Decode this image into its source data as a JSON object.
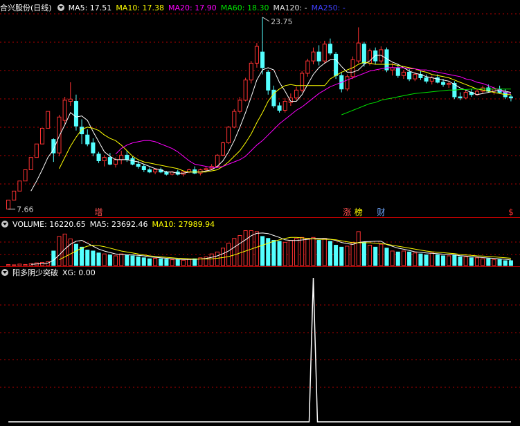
{
  "main_header": {
    "title": "合兴股份(日线)",
    "ma5": "MA5: 17.51",
    "ma10": "MA10: 17.38",
    "ma20": "MA20: 17.90",
    "ma60": "MA60: 18.30",
    "ma120": "MA120: -",
    "ma250": "MA250: -"
  },
  "volume_header": {
    "title": "VOLUME: 16220.65",
    "ma5": "MA5: 23692.46",
    "ma10": "MA10: 27989.94"
  },
  "indicator_header": {
    "title": "阳多阴少突破",
    "xg": "XG: 0.00"
  },
  "colors": {
    "up": "#ff3232",
    "down": "#54ffff",
    "ma5": "#ffffff",
    "ma10": "#ffff00",
    "ma20": "#ff00ff",
    "ma60": "#00e600",
    "grid": "#b40000",
    "ma120": "#e0e0e0",
    "ma250": "#4040ff"
  },
  "chart_data": [
    {
      "type": "candlestick",
      "title": "合兴股份(日线)",
      "ylim": [
        7.0,
        25.0
      ],
      "annotations": {
        "high_label": "23.75",
        "low_label": "7.66",
        "event_markers": [
          {
            "text": "增",
            "index": 16,
            "color": "#ff5050"
          },
          {
            "text": "涨",
            "index": 60,
            "color": "#ff5050"
          },
          {
            "text": "榜",
            "index": 62,
            "color": "#ffff00"
          },
          {
            "text": "财",
            "index": 66,
            "color": "#6fa8ff"
          },
          {
            "text": "$",
            "index": 89,
            "color": "#ff3232"
          }
        ]
      },
      "candles": [
        [
          7.6,
          8.4,
          7.6,
          8.4
        ],
        [
          8.4,
          9.2,
          8.4,
          9.2
        ],
        [
          9.2,
          10.1,
          9.2,
          10.1
        ],
        [
          10.1,
          11.1,
          10.1,
          11.1
        ],
        [
          11.1,
          12.2,
          11.1,
          12.2
        ],
        [
          12.2,
          13.4,
          12.2,
          13.4
        ],
        [
          13.4,
          14.8,
          13.4,
          14.8
        ],
        [
          14.8,
          16.3,
          14.8,
          16.3
        ],
        [
          13.8,
          13.9,
          11.8,
          12.6
        ],
        [
          12.6,
          16.0,
          12.3,
          15.8
        ],
        [
          15.5,
          17.6,
          15.2,
          17.3
        ],
        [
          17.2,
          18.9,
          16.8,
          17.4
        ],
        [
          17.2,
          17.8,
          14.6,
          15.0
        ],
        [
          14.9,
          15.6,
          13.4,
          14.3
        ],
        [
          14.2,
          14.7,
          13.2,
          13.4
        ],
        [
          13.5,
          13.9,
          12.3,
          12.6
        ],
        [
          12.5,
          12.7,
          11.7,
          11.9
        ],
        [
          11.9,
          12.4,
          11.4,
          12.2
        ],
        [
          12.2,
          12.6,
          11.5,
          11.6
        ],
        [
          11.6,
          12.2,
          11.3,
          12.0
        ],
        [
          12.0,
          12.8,
          11.6,
          12.4
        ],
        [
          12.4,
          12.8,
          11.8,
          12.0
        ],
        [
          12.1,
          12.3,
          11.5,
          11.6
        ],
        [
          11.6,
          11.9,
          11.2,
          11.4
        ],
        [
          11.4,
          11.6,
          10.9,
          11.1
        ],
        [
          11.1,
          11.3,
          10.8,
          10.9
        ],
        [
          10.9,
          11.2,
          10.7,
          11.1
        ],
        [
          11.1,
          11.3,
          10.8,
          10.9
        ],
        [
          10.9,
          11.0,
          10.6,
          10.7
        ],
        [
          10.7,
          11.0,
          10.6,
          10.9
        ],
        [
          10.9,
          11.1,
          10.6,
          10.7
        ],
        [
          10.7,
          11.0,
          10.5,
          10.9
        ],
        [
          10.9,
          11.2,
          10.8,
          11.1
        ],
        [
          11.1,
          11.4,
          10.7,
          10.8
        ],
        [
          10.8,
          11.2,
          10.6,
          11.1
        ],
        [
          11.1,
          11.4,
          10.9,
          11.2
        ],
        [
          11.2,
          11.6,
          11.1,
          11.4
        ],
        [
          11.4,
          12.5,
          11.3,
          12.4
        ],
        [
          12.4,
          13.6,
          12.3,
          13.5
        ],
        [
          13.5,
          15.0,
          13.4,
          14.9
        ],
        [
          14.9,
          16.5,
          14.8,
          16.3
        ],
        [
          16.3,
          17.6,
          16.1,
          17.3
        ],
        [
          17.3,
          19.3,
          17.2,
          19.1
        ],
        [
          19.1,
          20.8,
          18.8,
          20.6
        ],
        [
          20.6,
          22.4,
          20.2,
          22.1
        ],
        [
          21.6,
          24.7,
          19.6,
          20.2
        ],
        [
          19.8,
          20.0,
          17.8,
          18.2
        ],
        [
          18.2,
          18.6,
          16.6,
          16.8
        ],
        [
          16.8,
          17.1,
          16.2,
          16.4
        ],
        [
          16.4,
          17.5,
          16.2,
          17.2
        ],
        [
          17.1,
          17.9,
          16.8,
          17.5
        ],
        [
          17.5,
          18.5,
          17.3,
          18.2
        ],
        [
          18.2,
          19.9,
          18.0,
          19.7
        ],
        [
          19.7,
          21.0,
          19.4,
          20.8
        ],
        [
          20.8,
          22.0,
          20.5,
          21.6
        ],
        [
          21.6,
          22.2,
          20.4,
          20.8
        ],
        [
          20.8,
          22.6,
          20.6,
          22.3
        ],
        [
          22.3,
          22.8,
          21.3,
          21.5
        ],
        [
          21.4,
          21.6,
          19.2,
          19.5
        ],
        [
          19.5,
          19.8,
          18.0,
          18.3
        ],
        [
          18.3,
          19.6,
          18.1,
          19.4
        ],
        [
          19.4,
          21.2,
          19.2,
          20.9
        ],
        [
          20.8,
          23.8,
          20.6,
          22.4
        ],
        [
          22.3,
          22.5,
          20.3,
          20.6
        ],
        [
          20.6,
          21.9,
          20.4,
          21.7
        ],
        [
          21.7,
          22.0,
          20.5,
          20.8
        ],
        [
          20.8,
          22.1,
          20.6,
          21.8
        ],
        [
          21.8,
          22.0,
          19.8,
          20.0
        ],
        [
          20.0,
          20.6,
          19.5,
          20.2
        ],
        [
          20.2,
          20.5,
          19.3,
          19.5
        ],
        [
          19.5,
          20.0,
          19.2,
          19.8
        ],
        [
          19.8,
          20.1,
          19.0,
          19.2
        ],
        [
          19.2,
          19.8,
          19.0,
          19.6
        ],
        [
          19.6,
          19.9,
          19.1,
          19.3
        ],
        [
          19.3,
          19.6,
          18.8,
          19.0
        ],
        [
          19.0,
          19.5,
          18.7,
          19.3
        ],
        [
          19.3,
          19.6,
          18.8,
          18.9
        ],
        [
          18.9,
          19.2,
          18.5,
          18.7
        ],
        [
          18.7,
          19.0,
          18.4,
          18.8
        ],
        [
          18.8,
          19.0,
          17.4,
          17.6
        ],
        [
          17.6,
          18.0,
          17.3,
          17.5
        ],
        [
          17.5,
          18.2,
          17.4,
          18.0
        ],
        [
          18.0,
          18.3,
          17.6,
          17.8
        ],
        [
          17.8,
          18.3,
          17.7,
          18.1
        ],
        [
          18.1,
          18.6,
          17.9,
          18.4
        ],
        [
          18.4,
          18.7,
          18.0,
          18.1
        ],
        [
          18.1,
          18.5,
          17.8,
          18.3
        ],
        [
          18.3,
          18.6,
          17.9,
          18.0
        ],
        [
          18.0,
          18.3,
          17.4,
          17.6
        ],
        [
          17.6,
          17.8,
          17.2,
          17.5
        ]
      ],
      "ma5": [
        null,
        null,
        null,
        null,
        9.2,
        10.1,
        11.1,
        12.2,
        12.9,
        14.1,
        15.1,
        16.2,
        15.8,
        15.9,
        15.5,
        14.5,
        13.6,
        12.7,
        12.3,
        12.0,
        12.0,
        12.0,
        11.9,
        11.8,
        11.6,
        11.4,
        11.2,
        11.1,
        10.9,
        10.9,
        10.8,
        10.8,
        10.9,
        10.9,
        10.9,
        11.0,
        11.1,
        11.4,
        11.9,
        12.7,
        13.7,
        14.9,
        16.2,
        17.6,
        19.1,
        20.0,
        20.2,
        20.0,
        18.9,
        18.1,
        17.2,
        17.2,
        17.8,
        18.7,
        19.6,
        20.2,
        20.6,
        20.9,
        20.9,
        20.3,
        19.8,
        19.8,
        20.0,
        20.5,
        20.8,
        21.3,
        21.3,
        21.0,
        20.7,
        20.5,
        20.2,
        19.9,
        19.7,
        19.6,
        19.4,
        19.3,
        19.2,
        19.1,
        19.0,
        18.7,
        18.4,
        18.2,
        18.0,
        17.8,
        17.9,
        18.0,
        18.1,
        18.2,
        18.1,
        18.0
      ],
      "ma10": [
        null,
        null,
        null,
        null,
        null,
        null,
        null,
        null,
        null,
        11.2,
        12.2,
        13.2,
        14.0,
        14.7,
        14.9,
        14.8,
        14.6,
        14.2,
        13.9,
        13.7,
        13.3,
        12.8,
        12.3,
        12.0,
        11.8,
        11.7,
        11.6,
        11.5,
        11.4,
        11.3,
        11.2,
        11.0,
        10.9,
        10.9,
        10.9,
        10.9,
        11.0,
        11.1,
        11.4,
        11.8,
        12.3,
        12.8,
        13.5,
        14.3,
        15.3,
        16.2,
        17.2,
        17.9,
        18.3,
        18.6,
        18.7,
        18.6,
        18.6,
        18.6,
        18.6,
        18.6,
        18.6,
        19.2,
        19.5,
        19.8,
        20.0,
        20.2,
        20.5,
        20.7,
        20.6,
        20.5,
        20.5,
        20.5,
        20.5,
        20.4,
        20.3,
        20.2,
        20.1,
        19.9,
        19.8,
        19.6,
        19.5,
        19.4,
        19.3,
        19.1,
        18.9,
        18.7,
        18.5,
        18.3,
        18.2,
        18.1,
        18.0,
        17.9,
        17.8,
        17.8
      ],
      "ma20": [
        null,
        null,
        null,
        null,
        null,
        null,
        null,
        null,
        null,
        null,
        null,
        null,
        null,
        null,
        null,
        null,
        null,
        null,
        null,
        12.5,
        13.0,
        13.3,
        13.5,
        13.6,
        13.7,
        13.7,
        13.6,
        13.4,
        13.2,
        13.0,
        12.7,
        12.3,
        11.9,
        11.6,
        11.5,
        11.4,
        11.3,
        11.3,
        11.4,
        11.6,
        11.8,
        12.0,
        12.3,
        12.8,
        13.3,
        13.7,
        14.2,
        14.7,
        15.2,
        15.6,
        16.0,
        16.4,
        16.7,
        17.1,
        17.5,
        17.9,
        18.2,
        18.5,
        18.7,
        18.9,
        19.1,
        19.3,
        19.5,
        19.7,
        19.9,
        20.0,
        20.1,
        20.2,
        20.2,
        20.2,
        20.2,
        20.1,
        20.1,
        20.0,
        20.0,
        19.9,
        19.8,
        19.7,
        19.6,
        19.5,
        19.4,
        19.2,
        19.1,
        18.9,
        18.8,
        18.6,
        18.4,
        18.2,
        18.0,
        17.9
      ],
      "ma60": [
        null,
        null,
        null,
        null,
        null,
        null,
        null,
        null,
        null,
        null,
        null,
        null,
        null,
        null,
        null,
        null,
        null,
        null,
        null,
        null,
        null,
        null,
        null,
        null,
        null,
        null,
        null,
        null,
        null,
        null,
        null,
        null,
        null,
        null,
        null,
        null,
        null,
        null,
        null,
        null,
        null,
        null,
        null,
        null,
        null,
        null,
        null,
        null,
        null,
        null,
        null,
        null,
        null,
        null,
        null,
        null,
        null,
        null,
        null,
        16.0,
        16.2,
        16.4,
        16.6,
        16.8,
        17.0,
        17.1,
        17.3,
        17.4,
        17.5,
        17.6,
        17.7,
        17.8,
        17.9,
        17.95,
        18.0,
        18.05,
        18.1,
        18.15,
        18.2,
        18.2,
        18.25,
        18.25,
        18.3,
        18.3,
        18.3,
        18.3,
        18.3,
        18.3,
        18.3,
        18.3
      ]
    },
    {
      "type": "bar",
      "title": "VOLUME",
      "values": [
        2000,
        1500,
        3000,
        2200,
        4000,
        5500,
        6500,
        8000,
        30000,
        60000,
        65000,
        55000,
        44000,
        38000,
        32000,
        30000,
        26000,
        24000,
        22000,
        20000,
        24000,
        22000,
        20000,
        18000,
        16000,
        14000,
        15000,
        14000,
        13000,
        12000,
        12000,
        11000,
        13000,
        14000,
        16000,
        18000,
        24000,
        28000,
        36000,
        46000,
        56000,
        62000,
        72000,
        72000,
        70000,
        60000,
        56000,
        52000,
        50000,
        48000,
        52000,
        56000,
        58000,
        56000,
        58000,
        52000,
        56000,
        50000,
        42000,
        38000,
        40000,
        48000,
        70000,
        48000,
        42000,
        38000,
        44000,
        36000,
        30000,
        28000,
        30000,
        28000,
        26000,
        24000,
        22000,
        26000,
        22000,
        20000,
        20000,
        22000,
        18000,
        18000,
        16000,
        16000,
        14000,
        14000,
        12000,
        12000,
        10000,
        10000
      ],
      "ma5": [
        null,
        null,
        null,
        null,
        2500,
        3200,
        4200,
        5200,
        10800,
        22000,
        34000,
        44000,
        50000,
        52000,
        46000,
        40000,
        34000,
        30000,
        27000,
        24000,
        23000,
        22000,
        22000,
        21000,
        20000,
        18000,
        17000,
        16000,
        15000,
        14000,
        13000,
        12500,
        12500,
        12800,
        13500,
        14500,
        17000,
        20000,
        24500,
        30000,
        38000,
        45600,
        53200,
        61600,
        66400,
        67200,
        66000,
        62000,
        58000,
        53000,
        51600,
        51600,
        52800,
        54000,
        55600,
        56000,
        56000,
        54400,
        51600,
        47600,
        45200,
        43600,
        47600,
        49200,
        49600,
        50000,
        50400,
        43400,
        39600,
        36000,
        33600,
        31200,
        28400,
        27200,
        26000,
        25200,
        24400,
        23600,
        22400,
        22000,
        20400,
        19600,
        18400,
        17600,
        16400,
        15600,
        14800,
        14000,
        12800,
        11600
      ],
      "ma10": [
        null,
        null,
        null,
        null,
        null,
        null,
        null,
        null,
        null,
        12000,
        18000,
        24000,
        30000,
        36000,
        40000,
        42000,
        41000,
        39000,
        36000,
        33000,
        30000,
        28000,
        26000,
        24000,
        22000,
        20000,
        19000,
        18000,
        17000,
        16000,
        15000,
        14500,
        14000,
        13500,
        13500,
        13500,
        14000,
        15000,
        16500,
        18500,
        22000,
        26000,
        30000,
        34000,
        38000,
        42000,
        46000,
        50000,
        53000,
        56000,
        58000,
        58000,
        57000,
        56000,
        55000,
        54000,
        54000,
        54000,
        53000,
        51000,
        49000,
        47000,
        47000,
        47000,
        47000,
        46000,
        45000,
        44000,
        42000,
        40000,
        38000,
        36000,
        34000,
        32000,
        30000,
        28500,
        27500,
        26500,
        25500,
        24500,
        23000,
        22000,
        21000,
        20000,
        19500,
        19000,
        18000,
        17000,
        16000,
        15000
      ]
    },
    {
      "type": "line",
      "title": "阳多阴少突破",
      "ylim": [
        0,
        1
      ],
      "values": [
        0,
        0,
        0,
        0,
        0,
        0,
        0,
        0,
        0,
        0,
        0,
        0,
        0,
        0,
        0,
        0,
        0,
        0,
        0,
        0,
        0,
        0,
        0,
        0,
        0,
        0,
        0,
        0,
        0,
        0,
        0,
        0,
        0,
        0,
        0,
        0,
        0,
        0,
        0,
        0,
        0,
        0,
        0,
        0,
        0,
        0,
        0,
        0,
        0,
        0,
        0,
        0,
        0,
        0,
        0,
        0,
        0,
        0,
        0,
        0,
        0,
        0,
        0,
        0,
        0,
        0,
        0,
        0,
        0,
        0,
        0,
        0,
        0,
        0,
        0,
        0,
        0,
        0,
        0,
        0,
        0,
        0,
        0,
        0,
        0,
        0,
        0,
        0,
        0,
        0
      ],
      "spike": {
        "index": 54,
        "value": 1
      }
    }
  ]
}
